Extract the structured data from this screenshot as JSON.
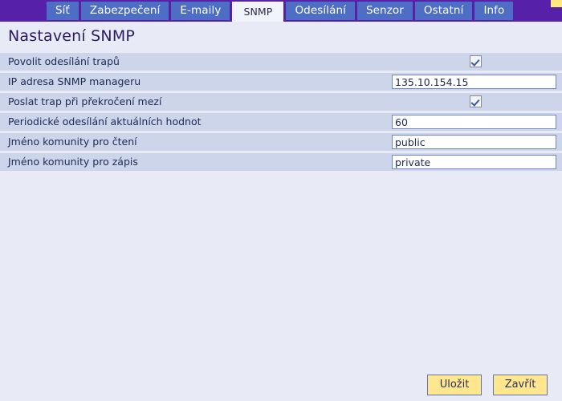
{
  "window": {
    "accent_purple": "#5620a8",
    "tab_blue": "#4d6ec4",
    "row_blue": "#ccd5ea",
    "page_bg": "#e8ebf5",
    "button_yellow": "#ffe68f",
    "title_color": "#2b1a66"
  },
  "tabs": [
    {
      "label": "Síť",
      "active": false
    },
    {
      "label": "Zabezpečení",
      "active": false
    },
    {
      "label": "E-maily",
      "active": false
    },
    {
      "label": "SNMP",
      "active": true
    },
    {
      "label": "Odesílání",
      "active": false
    },
    {
      "label": "Senzor",
      "active": false
    },
    {
      "label": "Ostatní",
      "active": false
    },
    {
      "label": "Info",
      "active": false
    }
  ],
  "page": {
    "title": "Nastavení SNMP"
  },
  "form": {
    "rows": [
      {
        "label": "Povolit odesílání trapů",
        "type": "checkbox",
        "checked": true
      },
      {
        "label": "IP adresa SNMP manageru",
        "type": "text",
        "value": "135.10.154.15",
        "placeholder": ""
      },
      {
        "label": "Poslat trap při překročení mezí",
        "type": "checkbox",
        "checked": true
      },
      {
        "label": "Periodické odesílání aktuálních hodnot",
        "type": "text",
        "value": "60",
        "placeholder": ""
      },
      {
        "label": "Jméno komunity pro čtení",
        "type": "text",
        "value": "public",
        "placeholder": ""
      },
      {
        "label": "Jméno komunity pro zápis",
        "type": "text",
        "value": "private",
        "placeholder": ""
      }
    ]
  },
  "footer": {
    "save_label": "Uložit",
    "close_label": "Zavřít"
  }
}
